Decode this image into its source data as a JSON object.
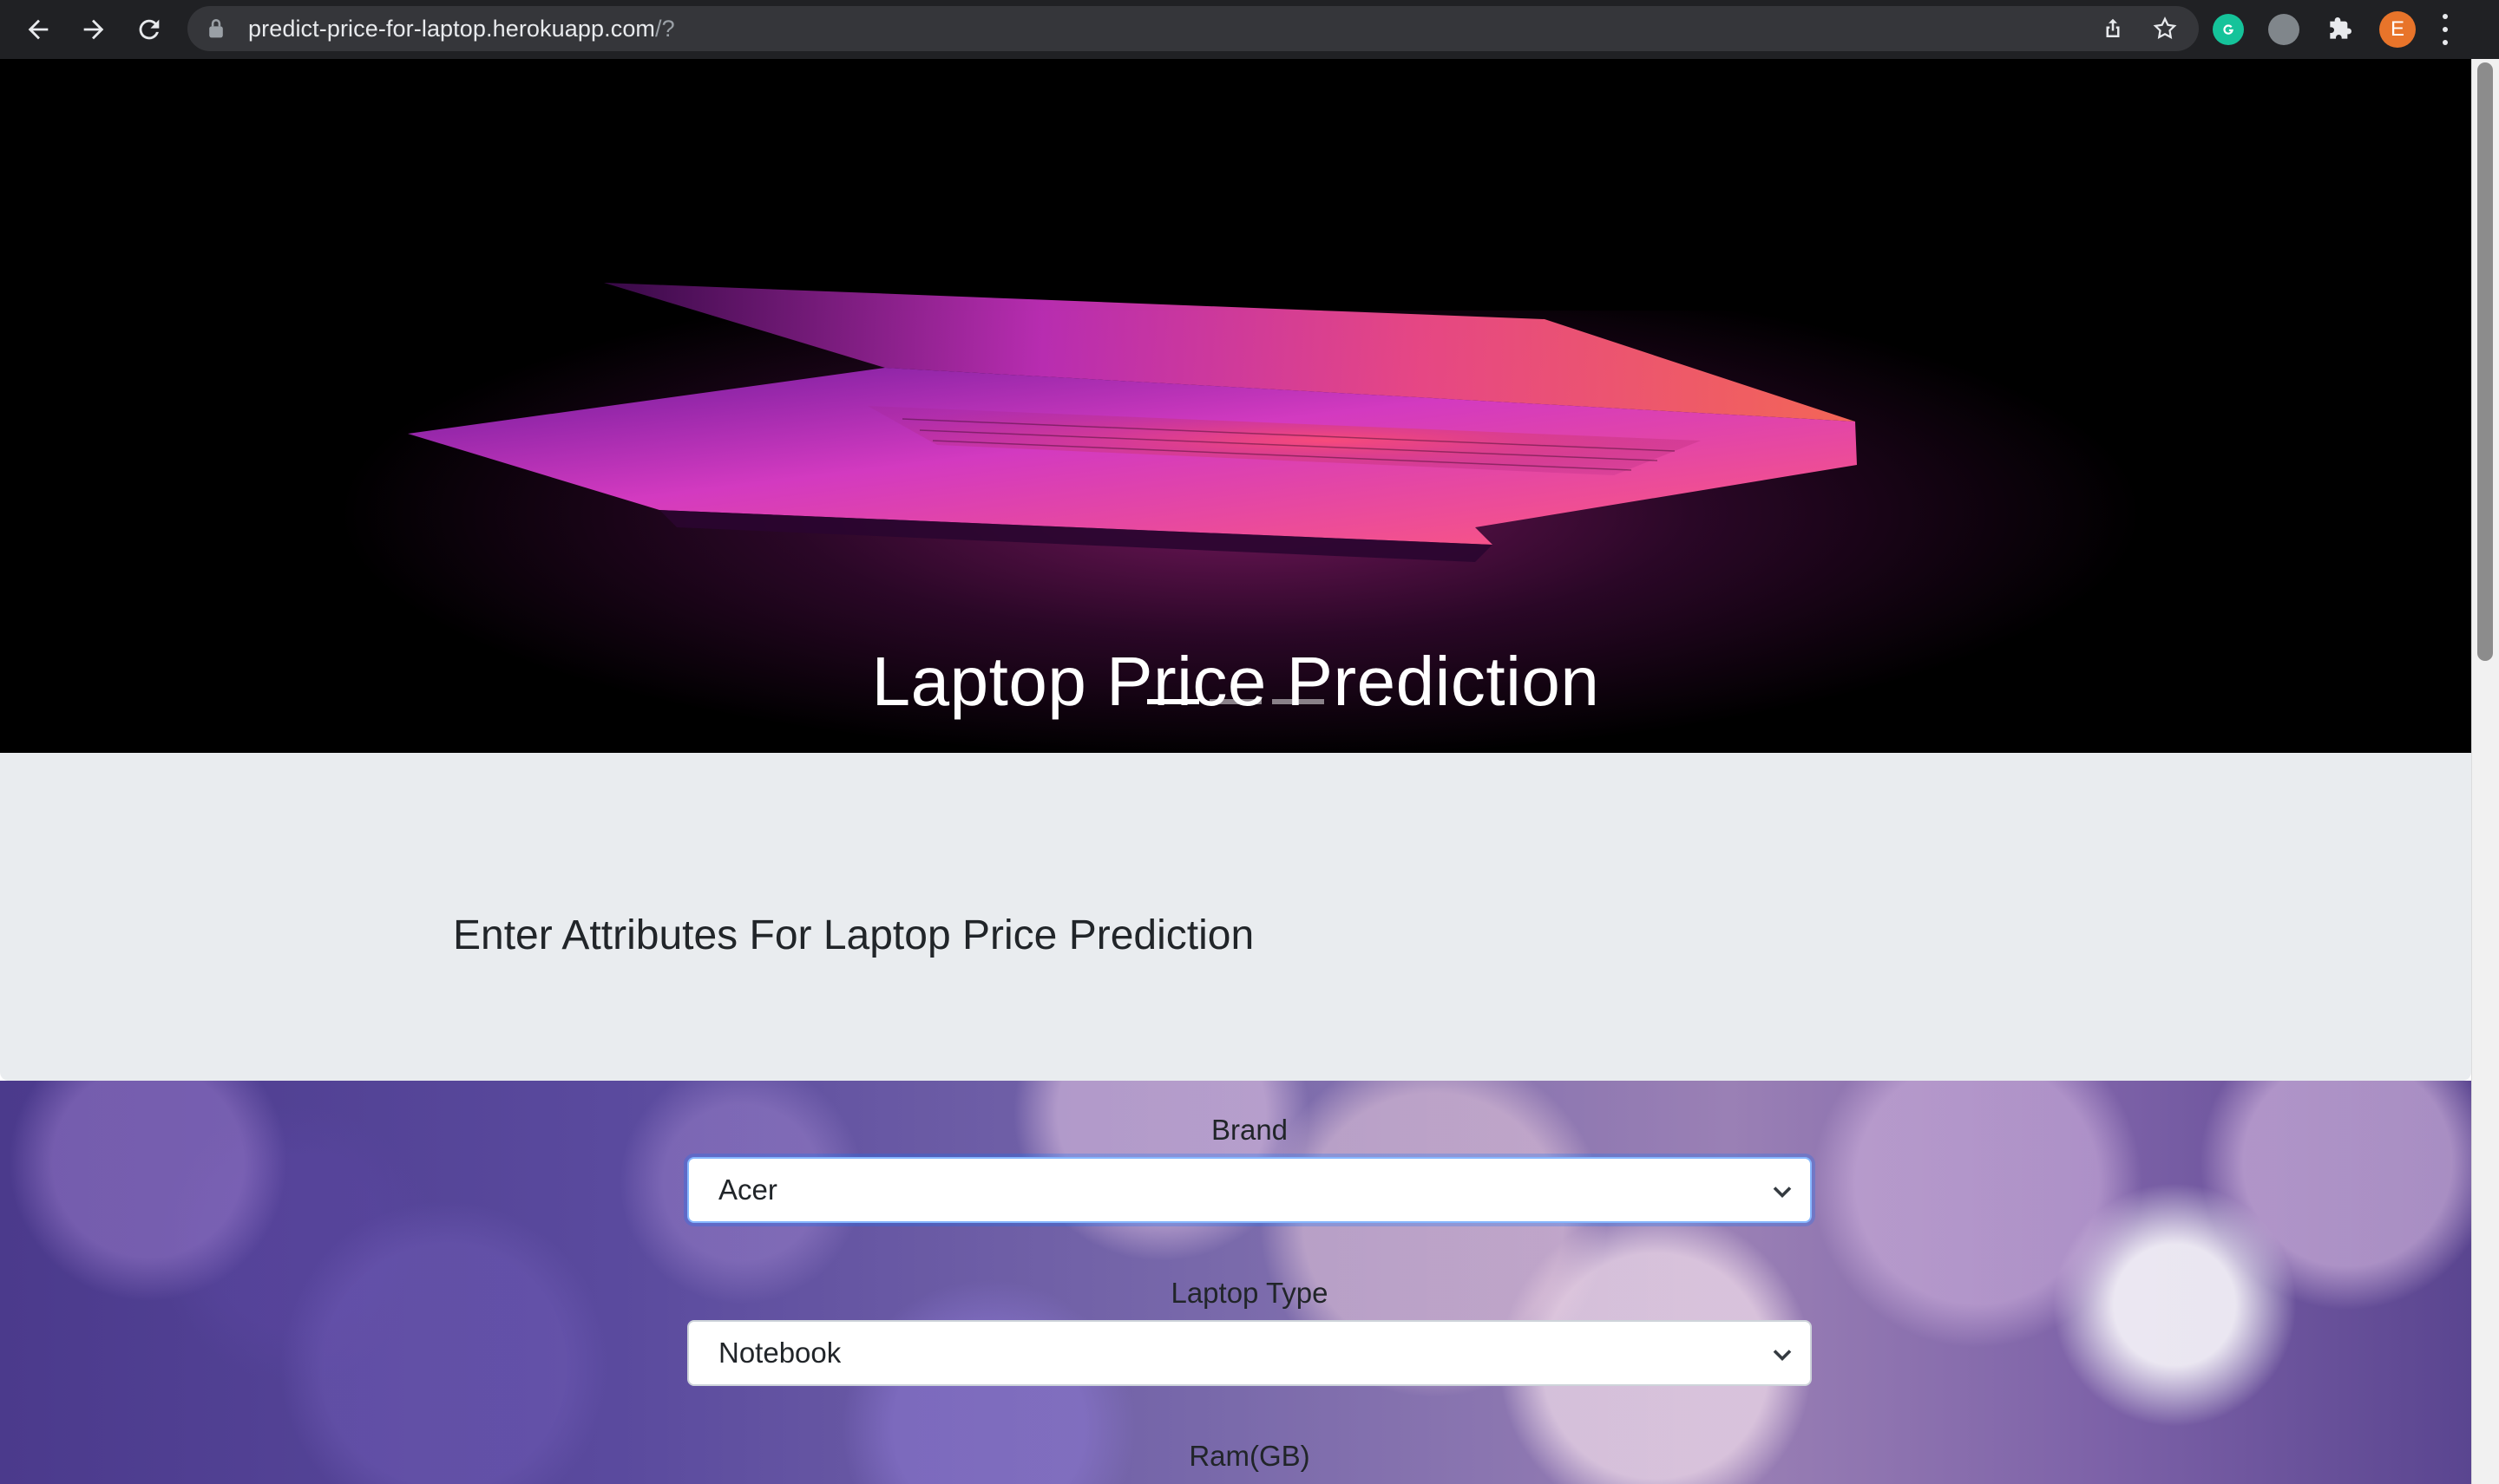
{
  "browser": {
    "url_host": "predict-price-for-laptop.herokuapp.com",
    "url_path": "/?",
    "avatar_letter": "E"
  },
  "hero": {
    "title": "Laptop Price Prediction",
    "slides": 3,
    "active_slide": 1
  },
  "attributes_panel": {
    "heading": "Enter Attributes For Laptop Price Prediction"
  },
  "form": {
    "fields": [
      {
        "label": "Brand",
        "value": "Acer"
      },
      {
        "label": "Laptop Type",
        "value": "Notebook"
      },
      {
        "label": "Ram(GB)",
        "value": ""
      }
    ]
  },
  "colors": {
    "accent_focus": "#86b7fe",
    "panel_bg": "#e9ecef"
  }
}
